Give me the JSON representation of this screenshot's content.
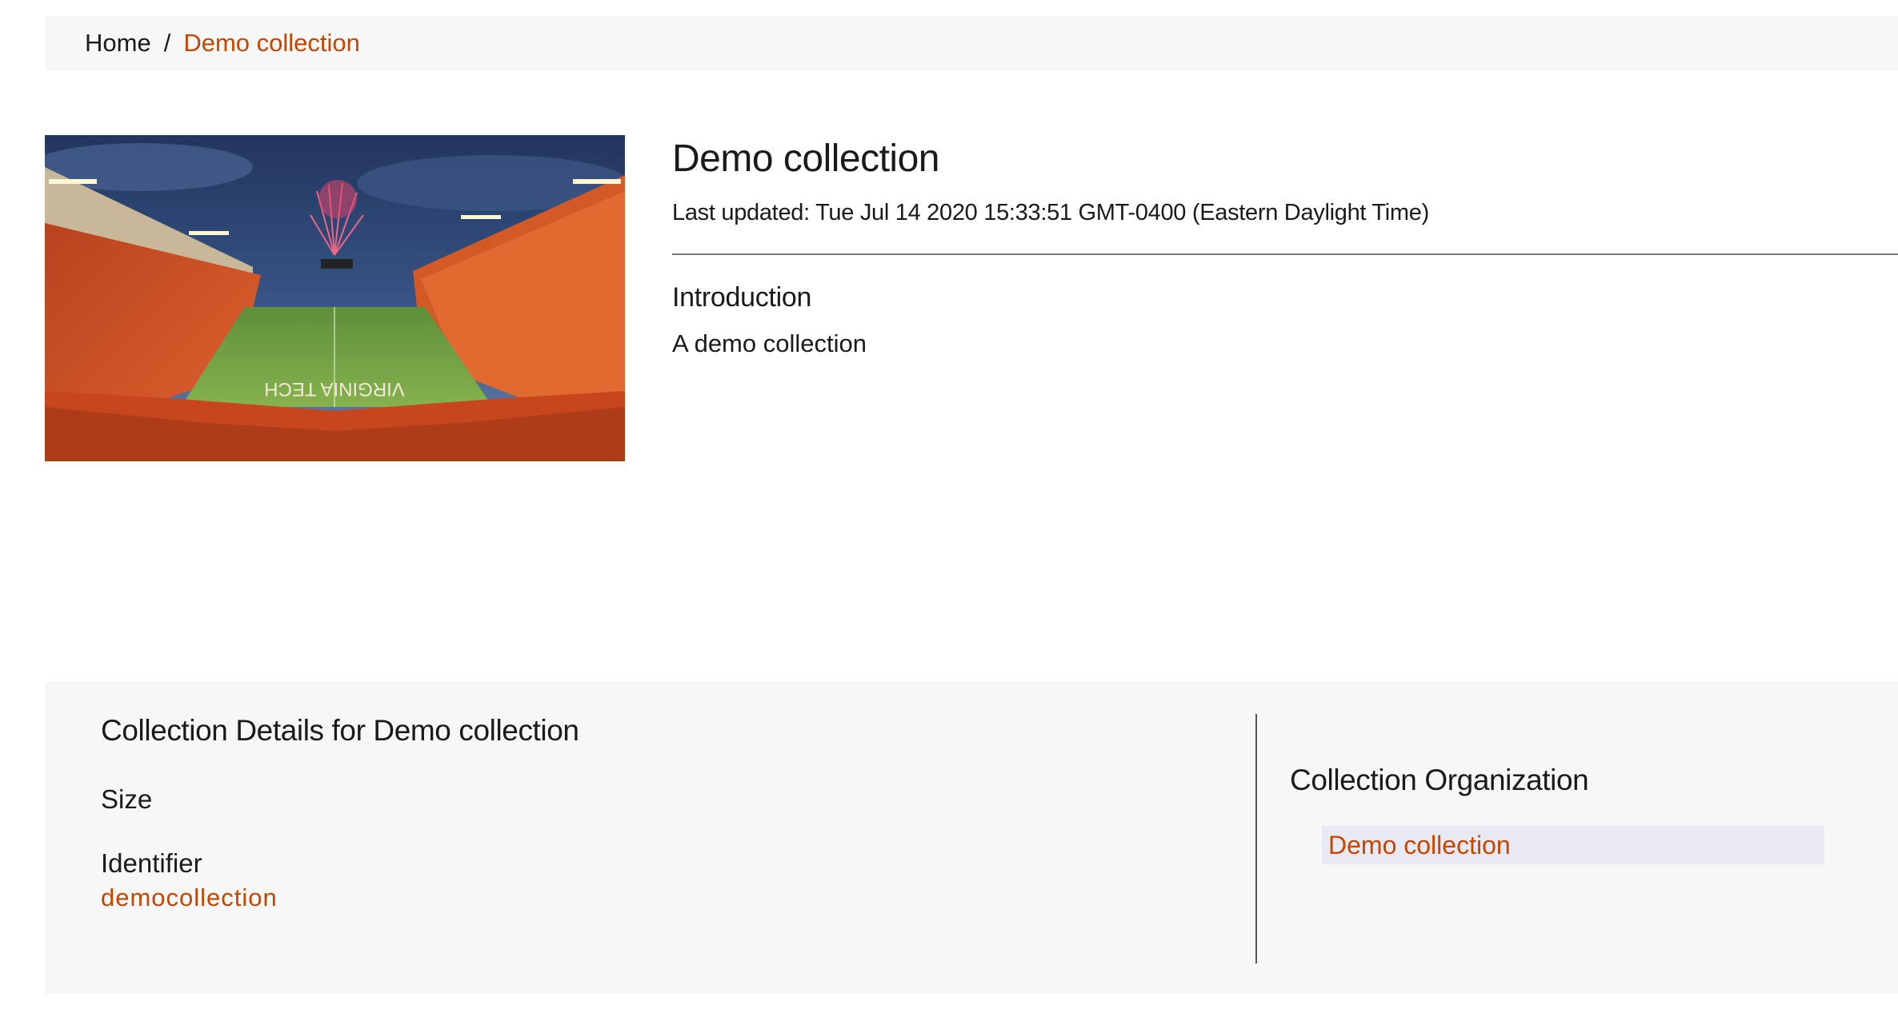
{
  "breadcrumb": {
    "home": "Home",
    "separator": "/",
    "current": "Demo collection"
  },
  "hero": {
    "image_icon": "stadium-photo",
    "image_caption_text": "VIRGINIA TECH",
    "title": "Demo collection",
    "last_updated": "Last updated: Tue Jul 14 2020 15:33:51 GMT-0400 (Eastern Daylight Time)",
    "intro_heading": "Introduction",
    "intro_text": "A demo collection"
  },
  "details": {
    "title": "Collection Details for Demo collection",
    "size_label": "Size",
    "identifier_label": "Identifier",
    "identifier_value": "democollection"
  },
  "organization": {
    "title": "Collection Organization",
    "items": [
      "Demo collection"
    ]
  },
  "colors": {
    "accent": "#c64600",
    "panel_bg": "#f7f7f7",
    "org_item_bg": "#e9e9f3"
  }
}
